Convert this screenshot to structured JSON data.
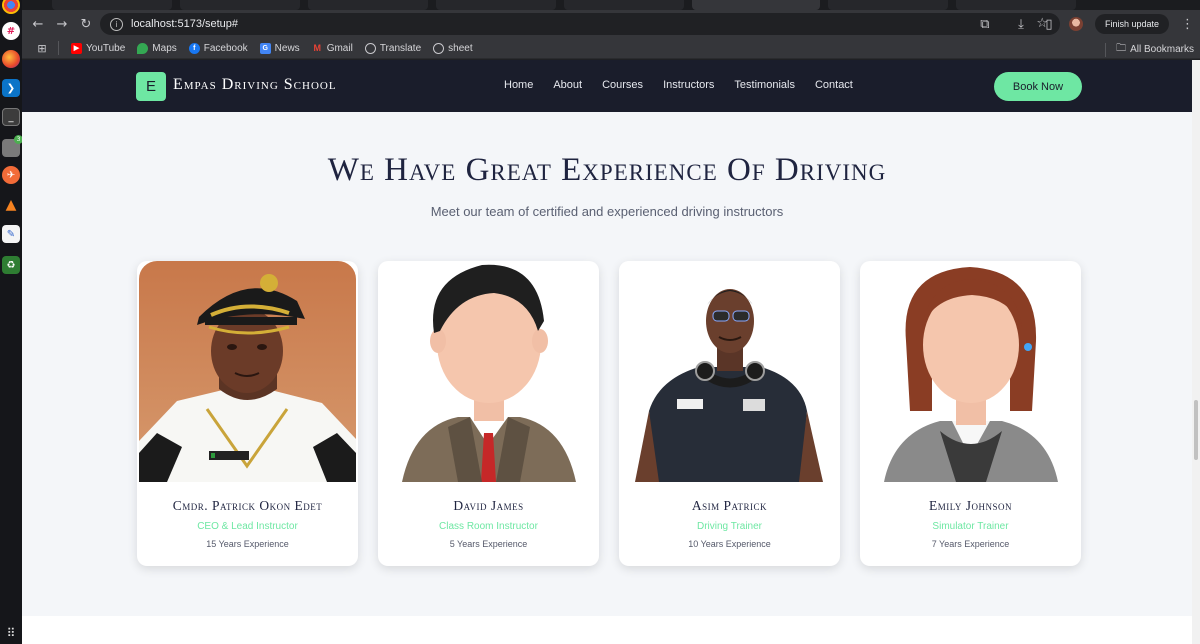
{
  "browser": {
    "url": "localhost:5173/setup#",
    "finish_update_label": "Finish update",
    "bookmarks": [
      {
        "label": "YouTube",
        "icon": "youtube-icon",
        "color": "#ff0000"
      },
      {
        "label": "Maps",
        "icon": "maps-icon",
        "color": "#34a853"
      },
      {
        "label": "Facebook",
        "icon": "facebook-icon",
        "color": "#1877f2"
      },
      {
        "label": "News",
        "icon": "news-icon",
        "color": "#4285f4"
      },
      {
        "label": "Gmail",
        "icon": "gmail-icon",
        "color": "#ea4335"
      },
      {
        "label": "Translate",
        "icon": "translate-icon",
        "color": "#9aa0a6"
      },
      {
        "label": "sheet",
        "icon": "globe-icon",
        "color": "#9aa0a6"
      }
    ],
    "all_bookmarks_label": "All Bookmarks"
  },
  "site": {
    "logo_letter": "E",
    "brand_name": "Empas Driving School",
    "nav": [
      "Home",
      "About",
      "Courses",
      "Instructors",
      "Testimonials",
      "Contact"
    ],
    "cta_label": "Book Now",
    "accent_color": "#6ee7a3",
    "nav_bg": "#1a1d2b"
  },
  "section": {
    "title": "We Have Great Experience Of Driving",
    "subtitle": "Meet our team of certified and experienced driving instructors"
  },
  "instructors": [
    {
      "name": "Cmdr. Patrick Okon Edet",
      "role": "CEO & Lead Instructor",
      "experience": "15 Years Experience",
      "photo": "officer-photo"
    },
    {
      "name": "David James",
      "role": "Class Room Instructor",
      "experience": "5 Years Experience",
      "photo": "male-avatar-illustration"
    },
    {
      "name": "Asim Patrick",
      "role": "Driving Trainer",
      "experience": "10 Years Experience",
      "photo": "man-with-headphones-photo"
    },
    {
      "name": "Emily Johnson",
      "role": "Simulator Trainer",
      "experience": "7 Years Experience",
      "photo": "female-avatar-illustration"
    }
  ]
}
